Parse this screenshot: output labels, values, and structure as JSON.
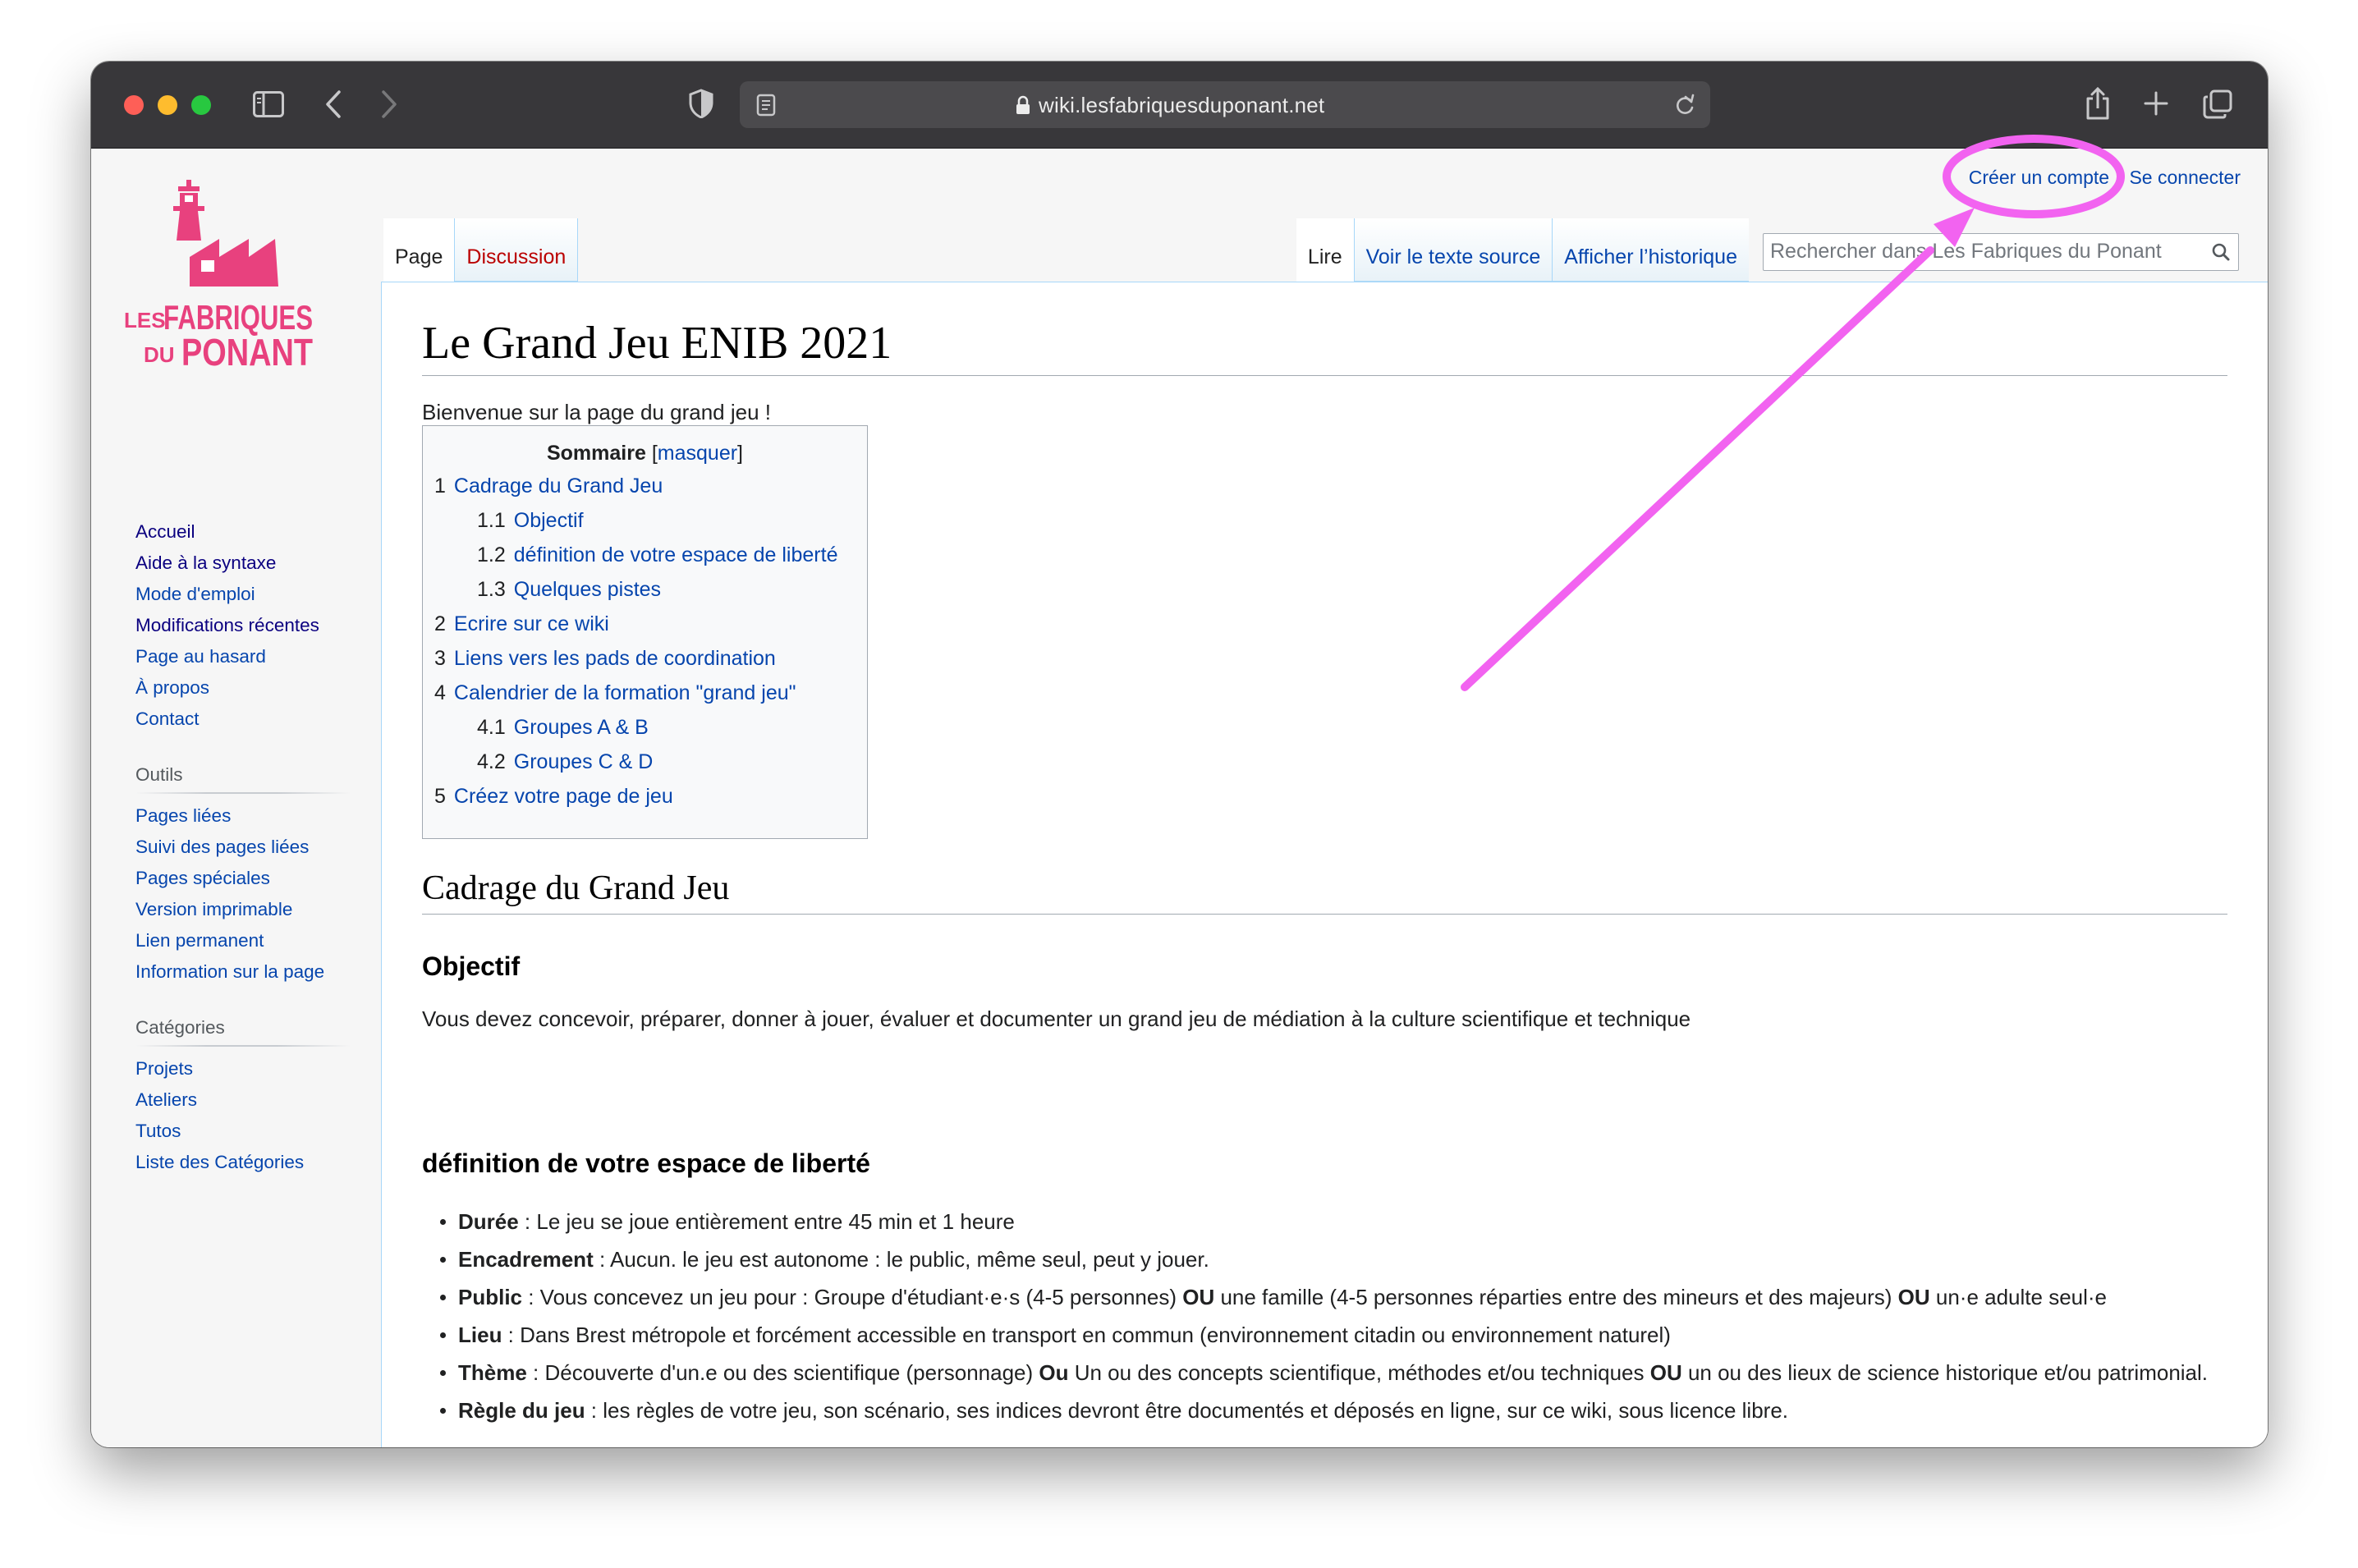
{
  "browser": {
    "url": "wiki.lesfabriquesduponant.net"
  },
  "logo": {
    "line1a": "LES",
    "line1b": "FABRIQUES",
    "line2a": "DU",
    "line2b": "PONANT"
  },
  "personal_tools": {
    "create_account": "Créer un compte",
    "login": "Se connecter"
  },
  "tabs": {
    "page": "Page",
    "discussion": "Discussion",
    "read": "Lire",
    "view_source": "Voir le texte source",
    "history": "Afficher l’historique"
  },
  "search": {
    "placeholder": "Rechercher dans Les Fabriques du Ponant"
  },
  "sidebar": {
    "navigation": [
      {
        "label": "Accueil"
      },
      {
        "label": "Aide à la syntaxe"
      },
      {
        "label": "Mode d'emploi"
      },
      {
        "label": "Modifications récentes"
      },
      {
        "label": "Page au hasard"
      },
      {
        "label": "À propos"
      },
      {
        "label": "Contact"
      }
    ],
    "tools_heading": "Outils",
    "tools": [
      {
        "label": "Pages liées"
      },
      {
        "label": "Suivi des pages liées"
      },
      {
        "label": "Pages spéciales"
      },
      {
        "label": "Version imprimable"
      },
      {
        "label": "Lien permanent"
      },
      {
        "label": "Information sur la page"
      }
    ],
    "categories_heading": "Catégories",
    "categories": [
      {
        "label": "Projets"
      },
      {
        "label": "Ateliers"
      },
      {
        "label": "Tutos"
      },
      {
        "label": "Liste des Catégories"
      }
    ]
  },
  "article": {
    "title": "Le Grand Jeu ENIB 2021",
    "intro": "Bienvenue sur la page du grand jeu !",
    "toc": {
      "title": "Sommaire",
      "toggle_open": "[",
      "toggle_label": "masquer",
      "toggle_close": "]",
      "items": [
        {
          "num": "1",
          "label": "Cadrage du Grand Jeu"
        },
        {
          "num": "1.1",
          "label": "Objectif"
        },
        {
          "num": "1.2",
          "label": "définition de votre espace de liberté"
        },
        {
          "num": "1.3",
          "label": "Quelques pistes"
        },
        {
          "num": "2",
          "label": "Ecrire sur ce wiki"
        },
        {
          "num": "3",
          "label": "Liens vers les pads de coordination"
        },
        {
          "num": "4",
          "label": "Calendrier de la formation \"grand jeu\""
        },
        {
          "num": "4.1",
          "label": "Groupes A & B"
        },
        {
          "num": "4.2",
          "label": "Groupes C & D"
        },
        {
          "num": "5",
          "label": "Créez votre page de jeu"
        }
      ]
    },
    "section1_heading": "Cadrage du Grand Jeu",
    "objectif_heading": "Objectif",
    "objectif_text": "Vous devez concevoir, préparer, donner à jouer, évaluer et documenter un grand jeu de médiation à la culture scientifique et technique",
    "liberte_heading": "définition de votre espace de liberté",
    "bullets": [
      {
        "parts": [
          {
            "b": "Durée"
          },
          {
            "t": " : Le jeu se joue entièrement entre 45 min et 1 heure"
          }
        ]
      },
      {
        "parts": [
          {
            "b": "Encadrement"
          },
          {
            "t": " : Aucun. le jeu est autonome : le public, même seul, peut y jouer."
          }
        ]
      },
      {
        "parts": [
          {
            "b": "Public"
          },
          {
            "t": " : Vous concevez un jeu pour : Groupe d'étudiant·e·s (4-5 personnes) "
          },
          {
            "b": "OU"
          },
          {
            "t": " une famille (4-5 personnes réparties entre des mineurs et des majeurs) "
          },
          {
            "b": "OU"
          },
          {
            "t": " un·e adulte seul·e"
          }
        ]
      },
      {
        "parts": [
          {
            "b": "Lieu"
          },
          {
            "t": " : Dans Brest métropole et forcément accessible en transport en commun (environnement citadin ou environnement naturel)"
          }
        ]
      },
      {
        "parts": [
          {
            "b": "Thème"
          },
          {
            "t": " : Découverte d'un.e ou des scientifique (personnage) "
          },
          {
            "b": "Ou"
          },
          {
            "t": " Un ou des concepts scientifique, méthodes et/ou techniques "
          },
          {
            "b": "OU"
          },
          {
            "t": " un ou des lieux de science historique et/ou patrimonial."
          }
        ]
      },
      {
        "parts": [
          {
            "b": "Règle du jeu"
          },
          {
            "t": " : les règles de votre jeu, son scénario, ses indices devront être documentés et déposés en ligne, sur ce wiki, sous licence libre."
          }
        ]
      }
    ]
  },
  "annotation": {
    "color": "#f263f0"
  }
}
